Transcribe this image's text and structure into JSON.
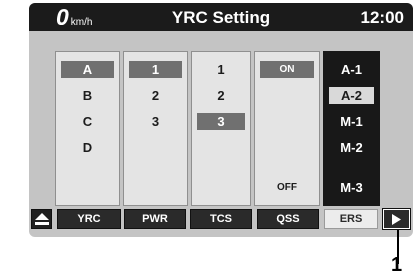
{
  "header": {
    "speed_value": "0",
    "speed_unit": "km/h",
    "title": "YRC Setting",
    "clock": "12:00"
  },
  "columns": {
    "yrc": {
      "items": [
        "A",
        "B",
        "C",
        "D"
      ],
      "selected": "A"
    },
    "pwr": {
      "items": [
        "1",
        "2",
        "3"
      ],
      "selected": "1"
    },
    "tcs": {
      "items": [
        "1",
        "2",
        "3"
      ],
      "selected": "3"
    },
    "qss": {
      "on_label": "ON",
      "off_label": "OFF",
      "selected": "ON"
    },
    "ers": {
      "items": [
        "A-1",
        "A-2",
        "M-1",
        "M-2",
        "M-3"
      ],
      "selected": "A-2"
    }
  },
  "tabs": {
    "eject_icon": "eject-icon",
    "yrc": "YRC",
    "pwr": "PWR",
    "tcs": "TCS",
    "qss": "QSS",
    "ers": "ERS",
    "active": "ERS",
    "next_icon": "play-arrow-icon"
  },
  "callout": {
    "label": "1"
  }
}
